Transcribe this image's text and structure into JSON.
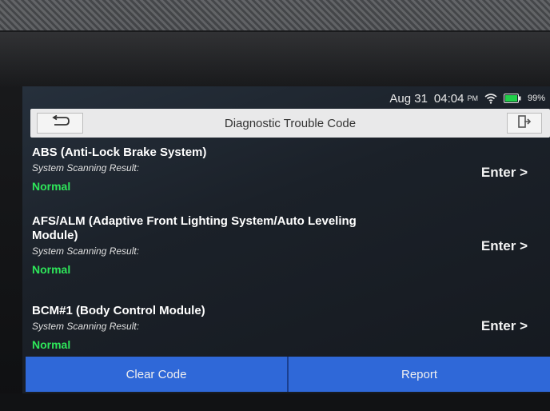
{
  "status_bar": {
    "date": "Aug 31",
    "time": "04:04",
    "time_suffix": "PM",
    "battery_percent": "99%",
    "wifi_icon": "wifi-icon",
    "battery_icon": "battery-icon"
  },
  "header": {
    "title": "Diagnostic Trouble Code",
    "back_icon": "back-arrow-icon",
    "exit_icon": "exit-icon"
  },
  "systems": [
    {
      "name": "ABS (Anti-Lock Brake System)",
      "result_label": "System Scanning Result:",
      "status": "Normal",
      "enter_label": "Enter >"
    },
    {
      "name": "AFS/ALM (Adaptive Front Lighting System/Auto Leveling Module)",
      "result_label": "System Scanning Result:",
      "status": "Normal",
      "enter_label": "Enter >"
    },
    {
      "name": "BCM#1 (Body Control Module)",
      "result_label": "System Scanning Result:",
      "status": "Normal",
      "enter_label": "Enter >"
    }
  ],
  "footer": {
    "clear_code_label": "Clear Code",
    "report_label": "Report"
  },
  "colors": {
    "status_normal": "#2ee65a",
    "button_blue": "#2f68d8"
  }
}
